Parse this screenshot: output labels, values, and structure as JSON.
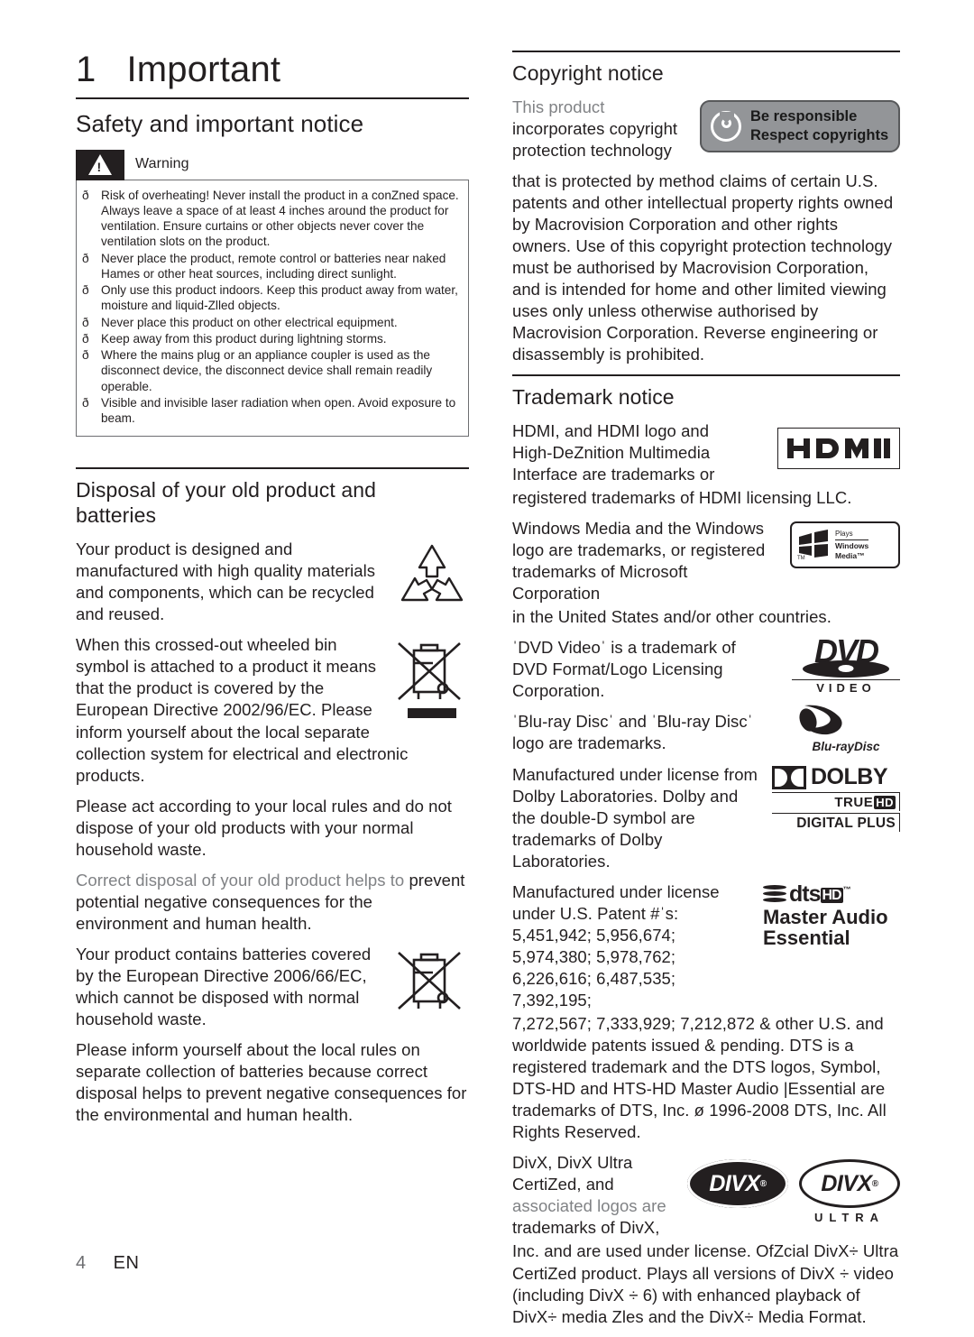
{
  "document": {
    "chapter_number": "1",
    "chapter_title": "Important",
    "footer": {
      "page_number": "4",
      "language": "EN"
    }
  },
  "left_column": {
    "section_heading": "Safety and important notice",
    "warning": {
      "label": "Warning",
      "icon": "warning-triangle-icon",
      "items": [
        "Risk of overheating! Never install the product in a conZned space. Always leave a space of at least 4 inches around the product for ventilation. Ensure curtains or other objects never cover the ventilation slots on the product.",
        "Never place the product, remote control or batteries near naked Hames or other heat sources, including direct sunlight.",
        "Only use this product indoors. Keep this product away from water, moisture and liquid-Zlled objects.",
        "Never place this product on other electrical equipment.",
        "Keep away from this product during lightning storms.",
        "Where the mains plug or an appliance coupler is used as the disconnect device, the disconnect device shall remain readily operable.",
        "Visible and invisible laser radiation when open. Avoid exposure to beam."
      ],
      "bullet_glyph": "ð"
    },
    "disposal": {
      "heading_line1": "Disposal of your old product and",
      "heading_line2": "batteries",
      "para1": "Your product is designed and manufactured with high quality materials and components, which can be recycled and reused.",
      "para2": "When this crossed-out wheeled bin symbol is attached to a product it means that the product is covered by the European Directive 2002/96/EC. Please inform yourself about the local separate collection system for electrical and electronic products.",
      "para3": "Please act according to your local rules and do not dispose of your old products with your normal household waste.",
      "para4_grey": "Correct disposal of your old product helps to",
      "para4_rest": "prevent potential negative consequences for the environment and human health.",
      "para5": "Your product contains batteries covered by the European Directive 2006/66/EC, which cannot be disposed with normal household waste.",
      "para6": "Please inform yourself about the local rules on separate collection of batteries because correct disposal helps to prevent negative consequences for the environmental and human health.",
      "figures": {
        "recycle": "recycle-arrows-icon",
        "weee_bin": "crossed-out-wheeled-bin-icon",
        "battery_bin": "crossed-out-wheeled-bin-battery-icon"
      }
    }
  },
  "right_column": {
    "copyright": {
      "heading": "Copyright notice",
      "intro_grey": "This product",
      "intro_rest": "incorporates copyright protection technology",
      "body": "that is protected by method claims of certain U.S. patents and other intellectual property rights owned by Macrovision Corporation and other rights owners. Use of this copyright protection technology must be authorised by Macrovision Corporation, and is intended for home and other limited viewing uses only unless otherwise authorised by Macrovision Corporation. Reverse engineering or disassembly is prohibited.",
      "badge": {
        "line1": "Be responsible",
        "line2": "Respect copyrights",
        "icon": "copyright-circle-icon",
        "background_color": "#939598",
        "border_color": "#58595b"
      }
    },
    "trademark": {
      "heading": "Trademark notice",
      "entries": [
        {
          "text_wrapped": "HDMI, and HDMI logo and High-DeZnition Multimedia Interface are trademarks or",
          "text_full_width": "registered trademarks of HDMI licensing LLC.",
          "logo": "hdmi-logo",
          "logo_text": "HDMI"
        },
        {
          "text_wrapped": "Windows Media and the Windows logo are trademarks, or registered trademarks of Microsoft Corporation",
          "text_full_width": "in the United States and/or other countries.",
          "logo": "plays-windows-media-logo",
          "logo_text_plays": "Plays",
          "logo_text_windows": "Windows",
          "logo_text_media": "Media™"
        },
        {
          "text_wrapped": "ˈDVD Videoˈ is a trademark of DVD Format/Logo Licensing Corporation.",
          "logo": "dvd-video-logo",
          "logo_text_dvd": "DVD",
          "logo_text_video": "VIDEO"
        },
        {
          "text_wrapped": "ˈBlu-ray Discˈ and ˈBlu-ray Discˈ logo are trademarks.",
          "logo": "blu-ray-disc-logo",
          "logo_text": "Blu-rayDisc"
        },
        {
          "text_wrapped": "Manufactured under license from Dolby Laboratories. Dolby and the double-D symbol are trademarks of Dolby Laboratories.",
          "logo": "dolby-truehd-digital-plus-logo",
          "logo_text_dolby": "DOLBY",
          "logo_text_true": "TRUE",
          "logo_text_hd": "HD",
          "logo_text_digital_plus": "DIGITAL PLUS"
        },
        {
          "text_wrapped": "Manufactured under license under U.S. Patent #ˈs: 5,451,942; 5,956,674; 5,974,380; 5,978,762; 6,226,616; 6,487,535; 7,392,195;",
          "text_full_width": "7,272,567; 7,333,929; 7,212,872 & other U.S. and worldwide patents issued & pending. DTS is a registered trademark and the DTS logos, Symbol, DTS-HD and HTS-HD Master Audio |Essential are trademarks of DTS, Inc. ø 1996-2008 DTS, Inc. All Rights Reserved.",
          "logo": "dts-hd-master-audio-essential-logo",
          "logo_text_dts": "dts",
          "logo_text_hd": "HD",
          "logo_text_master_audio": "Master Audio",
          "logo_text_essential": "Essential"
        },
        {
          "text_line1": "DivX, DivX Ultra",
          "text_line2": "CertiZed, and",
          "text_line3_grey": "associated logos are",
          "text_line4": "trademarks of DivX,",
          "text_full_width": "Inc. and are used under license. OfZcial DivX÷ Ultra CertiZed product. Plays all versions of DivX ÷ video (including DivX ÷ 6) with enhanced playback of DivX÷ media Zles and the DivX÷ Media Format.",
          "logo": "divx-logo",
          "logo_text": "DIVX",
          "logo_text_ultra": "ULTRA"
        }
      ]
    }
  }
}
